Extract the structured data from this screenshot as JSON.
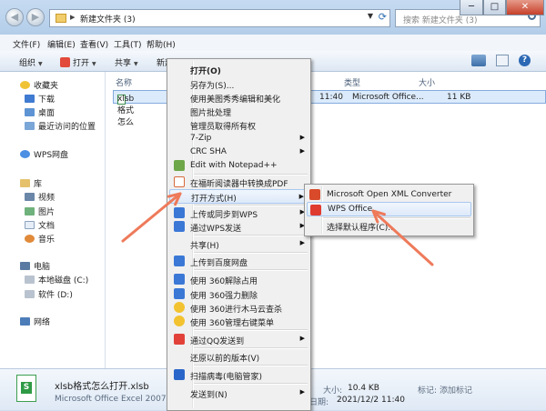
{
  "window": {
    "address_path": "新建文件夹 (3)",
    "search_placeholder": "搜索 新建文件夹 (3)",
    "minimize_label": "─",
    "maximize_label": "□",
    "close_label": "✕",
    "back_label": "◀",
    "forward_label": "▶"
  },
  "menubar": [
    "文件(F)",
    "编辑(E)",
    "查看(V)",
    "工具(T)",
    "帮助(H)"
  ],
  "toolbar": {
    "organize": "组织",
    "open": "打开",
    "share": "共享",
    "new_folder": "新建文件夹",
    "help": "?"
  },
  "sidebar": {
    "favorites": "收藏夹",
    "downloads": "下载",
    "desktop": "桌面",
    "recent": "最近访问的位置",
    "wps_drive": "WPS网盘",
    "libraries": "库",
    "videos": "视频",
    "pictures": "图片",
    "documents": "文档",
    "music": "音乐",
    "computer": "电脑",
    "local_disk": "本地磁盘 (C:)",
    "software": "软件 (D:)",
    "network": "网络"
  },
  "columns": {
    "name": "名称",
    "type": "类型",
    "size": "大小"
  },
  "file_row": {
    "name": "xlsb格式怎么",
    "time": "11:40",
    "type": "Microsoft Office...",
    "size": "11 KB"
  },
  "details": {
    "filename": "xlsb格式怎么打开.xlsb",
    "filetype": "Microsoft Office Excel 2007 二进",
    "size_label": "大小:",
    "size_value": "10.4 KB",
    "created_label": "创建日期:",
    "created_value": "2021/12/2 11:40",
    "tags_label": "标记:",
    "tags_value": "添加标记"
  },
  "context_menu": [
    {
      "label": "打开(O)",
      "bold": true
    },
    {
      "label": "另存为(S)..."
    },
    {
      "label": "使用美图秀秀编辑和美化"
    },
    {
      "label": "图片批处理"
    },
    {
      "label": "管理员取得所有权"
    },
    {
      "label": "7-Zip",
      "submenu": true
    },
    {
      "label": "CRC SHA",
      "submenu": true
    },
    {
      "label": "Edit with Notepad++"
    },
    {
      "label": "在福昕阅读器中转换成PDF"
    },
    {
      "label": "打开方式(H)",
      "submenu": true,
      "highlight": true
    },
    {
      "label": "上传或同步到WPS",
      "submenu": true
    },
    {
      "label": "通过WPS发送",
      "submenu": true
    },
    {
      "label": "共享(H)",
      "submenu": true
    },
    {
      "label": "上传到百度网盘"
    },
    {
      "label": "使用 360解除占用"
    },
    {
      "label": "使用 360强力删除"
    },
    {
      "label": "使用 360进行木马云查杀"
    },
    {
      "label": "使用 360管理右键菜单"
    },
    {
      "label": "通过QQ发送到",
      "submenu": true
    },
    {
      "label": "还原以前的版本(V)"
    },
    {
      "label": "扫描病毒(电脑管家)"
    },
    {
      "label": "发送到(N)",
      "submenu": true
    }
  ],
  "open_with_menu": [
    {
      "label": "Microsoft Open XML Converter"
    },
    {
      "label": "WPS Office",
      "highlight": true
    },
    {
      "label": "选择默认程序(C)..."
    }
  ],
  "colors": {
    "arrow": "#ee7a5a",
    "highlight": "#dde9f9",
    "menu_bg": "#f0f0f0"
  }
}
